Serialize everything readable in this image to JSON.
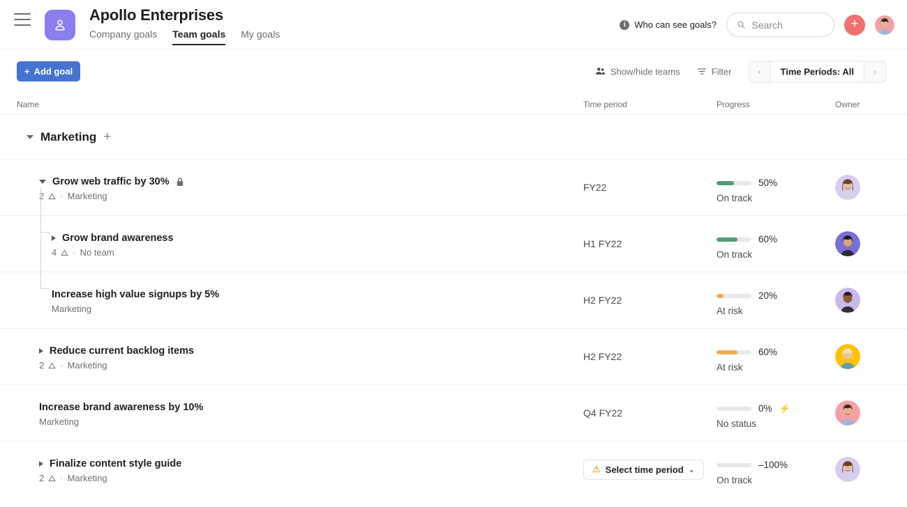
{
  "header": {
    "org_title": "Apollo Enterprises",
    "logo_color": "#8a7ef0",
    "menu_icon": "hamburger-icon",
    "tabs": [
      {
        "label": "Company goals",
        "active": false
      },
      {
        "label": "Team goals",
        "active": true
      },
      {
        "label": "My goals",
        "active": false
      }
    ],
    "who_can_see": "Who can see goals?",
    "info_glyph": "i",
    "search": {
      "placeholder": "Search",
      "value": ""
    },
    "plus_label": "+",
    "plus_color": "#f0716e"
  },
  "toolbar": {
    "add_goal": "Add goal",
    "add_goal_plus": "+",
    "add_goal_color": "#4573d2",
    "show_hide_teams": "Show/hide teams",
    "filter": "Filter",
    "time_periods": "Time Periods: All",
    "prev_arrow": "‹",
    "next_arrow": "›"
  },
  "columns": {
    "name": "Name",
    "time_period": "Time period",
    "progress": "Progress",
    "owner": "Owner"
  },
  "group": {
    "name": "Marketing",
    "add_glyph": "+"
  },
  "rows": [
    {
      "title": "Grow web traffic by 30%",
      "indent": 56,
      "caret": "down",
      "locked": true,
      "sub_count": "2",
      "sub_sep": "·",
      "team": "Marketing",
      "time_period": "FY22",
      "period_is_chip": false,
      "progress_pct": "50%",
      "progress_value": 50,
      "progress_color": "#4f9d73",
      "status": "On track",
      "bolt": false,
      "avatar_bg": "#d7cdf2",
      "avatar_variant": "woman-brown-bob"
    },
    {
      "title": "Grow brand awareness",
      "indent": 74,
      "caret": "right",
      "locked": false,
      "sub_count": "4",
      "sub_sep": "·",
      "team": "No team",
      "time_period": "H1 FY22",
      "period_is_chip": false,
      "progress_pct": "60%",
      "progress_value": 60,
      "progress_color": "#4f9d73",
      "status": "On track",
      "bolt": false,
      "avatar_bg": "#7a6fd8",
      "avatar_variant": "person-dark-hair"
    },
    {
      "title": "Increase high value signups by 5%",
      "indent": 74,
      "caret": "none",
      "locked": false,
      "sub_count": "",
      "sub_sep": "",
      "team": "Marketing",
      "time_period": "H2 FY22",
      "period_is_chip": false,
      "progress_pct": "20%",
      "progress_value": 20,
      "progress_color": "#eead53",
      "status": "At risk",
      "bolt": false,
      "avatar_bg": "#c9b9ea",
      "avatar_variant": "man-short-hair"
    },
    {
      "title": "Reduce current backlog items",
      "indent": 56,
      "caret": "right",
      "locked": false,
      "sub_count": "2",
      "sub_sep": "·",
      "team": "Marketing",
      "time_period": "H2 FY22",
      "period_is_chip": false,
      "progress_pct": "60%",
      "progress_value": 60,
      "progress_color": "#eead53",
      "status": "At risk",
      "bolt": false,
      "avatar_bg": "#ffc107",
      "avatar_variant": "woman-blonde"
    },
    {
      "title": "Increase brand awareness by 10%",
      "indent": 56,
      "caret": "none",
      "locked": false,
      "sub_count": "",
      "sub_sep": "",
      "team": "Marketing",
      "time_period": "Q4 FY22",
      "period_is_chip": false,
      "progress_pct": "0%",
      "progress_value": 0,
      "progress_color": "#e8e8e8",
      "status": "No status",
      "bolt": true,
      "bolt_glyph": "⚡",
      "avatar_bg": "#f4a0a8",
      "avatar_variant": "man-smiling"
    },
    {
      "title": "Finalize content style guide",
      "indent": 56,
      "caret": "right",
      "locked": false,
      "sub_count": "2",
      "sub_sep": "·",
      "team": "Marketing",
      "time_period": "Select time period",
      "period_is_chip": true,
      "period_warning_glyph": "⚠",
      "period_chip_caret": "⌄",
      "progress_pct": "–100%",
      "progress_value": 0,
      "progress_color": "#e8e8e8",
      "status": "On track",
      "bolt": false,
      "avatar_bg": "#d7cdf2",
      "avatar_variant": "woman-brown-bob"
    }
  ]
}
